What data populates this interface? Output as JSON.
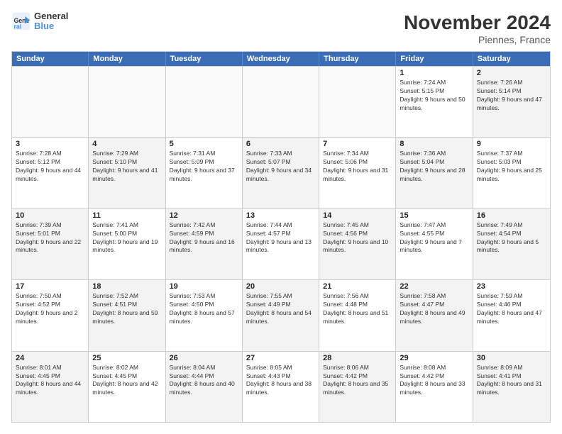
{
  "logo": {
    "line1": "General",
    "line2": "Blue"
  },
  "title": "November 2024",
  "location": "Piennes, France",
  "header_days": [
    "Sunday",
    "Monday",
    "Tuesday",
    "Wednesday",
    "Thursday",
    "Friday",
    "Saturday"
  ],
  "rows": [
    [
      {
        "day": "",
        "info": "",
        "empty": true
      },
      {
        "day": "",
        "info": "",
        "empty": true
      },
      {
        "day": "",
        "info": "",
        "empty": true
      },
      {
        "day": "",
        "info": "",
        "empty": true
      },
      {
        "day": "",
        "info": "",
        "empty": true
      },
      {
        "day": "1",
        "info": "Sunrise: 7:24 AM\nSunset: 5:15 PM\nDaylight: 9 hours and 50 minutes."
      },
      {
        "day": "2",
        "info": "Sunrise: 7:26 AM\nSunset: 5:14 PM\nDaylight: 9 hours and 47 minutes.",
        "shade": true
      }
    ],
    [
      {
        "day": "3",
        "info": "Sunrise: 7:28 AM\nSunset: 5:12 PM\nDaylight: 9 hours and 44 minutes."
      },
      {
        "day": "4",
        "info": "Sunrise: 7:29 AM\nSunset: 5:10 PM\nDaylight: 9 hours and 41 minutes.",
        "shade": true
      },
      {
        "day": "5",
        "info": "Sunrise: 7:31 AM\nSunset: 5:09 PM\nDaylight: 9 hours and 37 minutes."
      },
      {
        "day": "6",
        "info": "Sunrise: 7:33 AM\nSunset: 5:07 PM\nDaylight: 9 hours and 34 minutes.",
        "shade": true
      },
      {
        "day": "7",
        "info": "Sunrise: 7:34 AM\nSunset: 5:06 PM\nDaylight: 9 hours and 31 minutes."
      },
      {
        "day": "8",
        "info": "Sunrise: 7:36 AM\nSunset: 5:04 PM\nDaylight: 9 hours and 28 minutes.",
        "shade": true
      },
      {
        "day": "9",
        "info": "Sunrise: 7:37 AM\nSunset: 5:03 PM\nDaylight: 9 hours and 25 minutes."
      }
    ],
    [
      {
        "day": "10",
        "info": "Sunrise: 7:39 AM\nSunset: 5:01 PM\nDaylight: 9 hours and 22 minutes.",
        "shade": true
      },
      {
        "day": "11",
        "info": "Sunrise: 7:41 AM\nSunset: 5:00 PM\nDaylight: 9 hours and 19 minutes."
      },
      {
        "day": "12",
        "info": "Sunrise: 7:42 AM\nSunset: 4:59 PM\nDaylight: 9 hours and 16 minutes.",
        "shade": true
      },
      {
        "day": "13",
        "info": "Sunrise: 7:44 AM\nSunset: 4:57 PM\nDaylight: 9 hours and 13 minutes."
      },
      {
        "day": "14",
        "info": "Sunrise: 7:45 AM\nSunset: 4:56 PM\nDaylight: 9 hours and 10 minutes.",
        "shade": true
      },
      {
        "day": "15",
        "info": "Sunrise: 7:47 AM\nSunset: 4:55 PM\nDaylight: 9 hours and 7 minutes."
      },
      {
        "day": "16",
        "info": "Sunrise: 7:49 AM\nSunset: 4:54 PM\nDaylight: 9 hours and 5 minutes.",
        "shade": true
      }
    ],
    [
      {
        "day": "17",
        "info": "Sunrise: 7:50 AM\nSunset: 4:52 PM\nDaylight: 9 hours and 2 minutes."
      },
      {
        "day": "18",
        "info": "Sunrise: 7:52 AM\nSunset: 4:51 PM\nDaylight: 8 hours and 59 minutes.",
        "shade": true
      },
      {
        "day": "19",
        "info": "Sunrise: 7:53 AM\nSunset: 4:50 PM\nDaylight: 8 hours and 57 minutes."
      },
      {
        "day": "20",
        "info": "Sunrise: 7:55 AM\nSunset: 4:49 PM\nDaylight: 8 hours and 54 minutes.",
        "shade": true
      },
      {
        "day": "21",
        "info": "Sunrise: 7:56 AM\nSunset: 4:48 PM\nDaylight: 8 hours and 51 minutes."
      },
      {
        "day": "22",
        "info": "Sunrise: 7:58 AM\nSunset: 4:47 PM\nDaylight: 8 hours and 49 minutes.",
        "shade": true
      },
      {
        "day": "23",
        "info": "Sunrise: 7:59 AM\nSunset: 4:46 PM\nDaylight: 8 hours and 47 minutes."
      }
    ],
    [
      {
        "day": "24",
        "info": "Sunrise: 8:01 AM\nSunset: 4:45 PM\nDaylight: 8 hours and 44 minutes.",
        "shade": true
      },
      {
        "day": "25",
        "info": "Sunrise: 8:02 AM\nSunset: 4:45 PM\nDaylight: 8 hours and 42 minutes."
      },
      {
        "day": "26",
        "info": "Sunrise: 8:04 AM\nSunset: 4:44 PM\nDaylight: 8 hours and 40 minutes.",
        "shade": true
      },
      {
        "day": "27",
        "info": "Sunrise: 8:05 AM\nSunset: 4:43 PM\nDaylight: 8 hours and 38 minutes."
      },
      {
        "day": "28",
        "info": "Sunrise: 8:06 AM\nSunset: 4:42 PM\nDaylight: 8 hours and 35 minutes.",
        "shade": true
      },
      {
        "day": "29",
        "info": "Sunrise: 8:08 AM\nSunset: 4:42 PM\nDaylight: 8 hours and 33 minutes."
      },
      {
        "day": "30",
        "info": "Sunrise: 8:09 AM\nSunset: 4:41 PM\nDaylight: 8 hours and 31 minutes.",
        "shade": true
      }
    ]
  ]
}
